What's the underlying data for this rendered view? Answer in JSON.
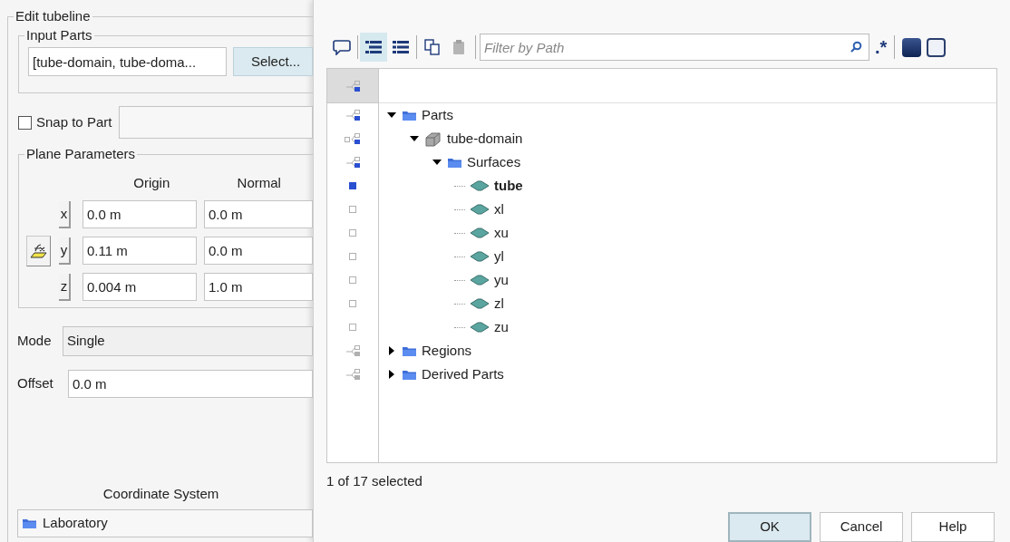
{
  "edit_panel": {
    "title": "Edit tubeline",
    "input_parts": {
      "title": "Input Parts",
      "value": "[tube-domain, tube-doma...",
      "button": "Select..."
    },
    "snap_to_part": {
      "label": "Snap to Part",
      "checked": false
    },
    "plane_parameters": {
      "title": "Plane Parameters",
      "columns": [
        "Origin",
        "Normal"
      ],
      "rows": [
        {
          "axis": "x",
          "origin": "0.0 m",
          "normal": "0.0 m"
        },
        {
          "axis": "y",
          "origin": "0.11 m",
          "normal": "0.0 m"
        },
        {
          "axis": "z",
          "origin": "0.004 m",
          "normal": "1.0 m"
        }
      ]
    },
    "mode": {
      "label": "Mode",
      "value": "Single"
    },
    "offset": {
      "label": "Offset",
      "value": "0.0 m"
    },
    "coordinate_system": {
      "label": "Coordinate System",
      "value": "Laboratory"
    }
  },
  "dialog": {
    "toolbar_groups": [
      [
        {
          "kind": "comment",
          "selected": false,
          "disabled": false
        }
      ],
      [
        {
          "kind": "tree-view",
          "selected": true,
          "disabled": false
        },
        {
          "kind": "list-view",
          "selected": false,
          "disabled": false
        }
      ],
      [
        {
          "kind": "copy",
          "selected": false,
          "disabled": false
        },
        {
          "kind": "paste",
          "selected": false,
          "disabled": true
        }
      ]
    ],
    "filter": {
      "placeholder": "Filter by Path"
    },
    "regex_toggle": ".*",
    "selection_buttons": [
      {
        "kind": "select-all"
      },
      {
        "kind": "select-none"
      }
    ],
    "tree": {
      "header_partly_selected": true,
      "nodes": [
        {
          "label": "Parts",
          "kind": "folder",
          "partly_selected": true,
          "expanded": true,
          "children": [
            {
              "label": "tube-domain",
              "kind": "part",
              "partly_selected": true,
              "expanded": true,
              "children": [
                {
                  "label": "Surfaces",
                  "kind": "folder",
                  "partly_selected": true,
                  "expanded": true,
                  "children": [
                    {
                      "label": "tube",
                      "kind": "surface",
                      "selected": true
                    },
                    {
                      "label": "xl",
                      "kind": "surface",
                      "selected": false
                    },
                    {
                      "label": "xu",
                      "kind": "surface",
                      "selected": false
                    },
                    {
                      "label": "yl",
                      "kind": "surface",
                      "selected": false
                    },
                    {
                      "label": "yu",
                      "kind": "surface",
                      "selected": false
                    },
                    {
                      "label": "zl",
                      "kind": "surface",
                      "selected": false
                    },
                    {
                      "label": "zu",
                      "kind": "surface",
                      "selected": false
                    }
                  ]
                }
              ]
            }
          ]
        },
        {
          "label": "Regions",
          "kind": "folder",
          "partly_selected": false,
          "expanded": false
        },
        {
          "label": "Derived Parts",
          "kind": "folder",
          "partly_selected": false,
          "expanded": false
        }
      ]
    },
    "status": "1 of 17 selected",
    "buttons": [
      {
        "label": "OK",
        "default": true
      },
      {
        "label": "Cancel",
        "default": false
      },
      {
        "label": "Help",
        "default": false
      }
    ]
  }
}
